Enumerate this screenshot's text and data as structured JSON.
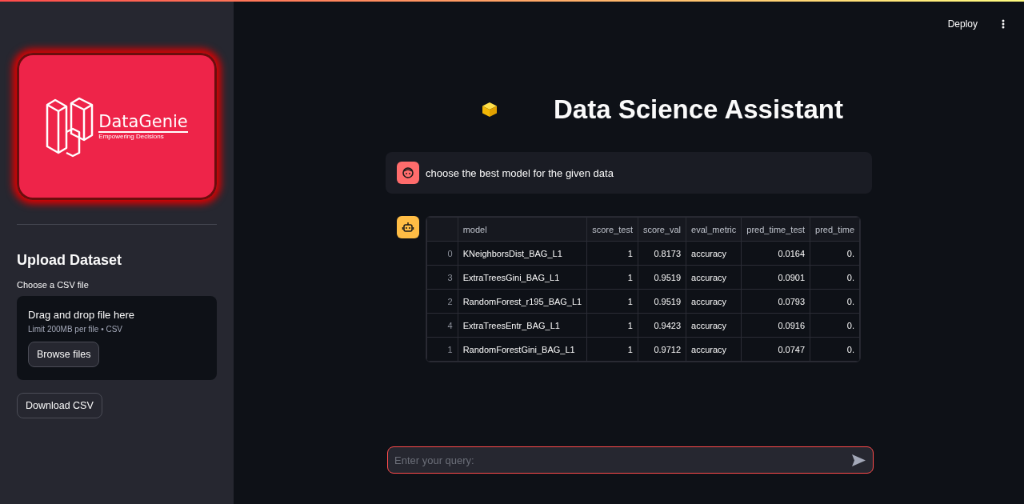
{
  "header": {
    "deploy": "Deploy"
  },
  "sidebar": {
    "logo": {
      "name": "DataGenie",
      "tagline": "Empowering Decisions"
    },
    "upload": {
      "title": "Upload Dataset",
      "label": "Choose a CSV file",
      "drop_text": "Drag and drop file here",
      "limit": "Limit 200MB per file • CSV",
      "browse": "Browse files"
    },
    "download": "Download CSV"
  },
  "title": "Data Science Assistant",
  "messages": [
    {
      "kind": "user",
      "text": "choose the best model for the given data"
    },
    {
      "kind": "assistant",
      "table": {
        "columns": [
          "",
          "model",
          "score_test",
          "score_val",
          "eval_metric",
          "pred_time_test",
          "pred_time"
        ],
        "rows": [
          [
            "0",
            "KNeighborsDist_BAG_L1",
            "1",
            "0.8173",
            "accuracy",
            "0.0164",
            "0."
          ],
          [
            "3",
            "ExtraTreesGini_BAG_L1",
            "1",
            "0.9519",
            "accuracy",
            "0.0901",
            "0."
          ],
          [
            "2",
            "RandomForest_r195_BAG_L1",
            "1",
            "0.9519",
            "accuracy",
            "0.0793",
            "0."
          ],
          [
            "4",
            "ExtraTreesEntr_BAG_L1",
            "1",
            "0.9423",
            "accuracy",
            "0.0916",
            "0."
          ],
          [
            "1",
            "RandomForestGini_BAG_L1",
            "1",
            "0.9712",
            "accuracy",
            "0.0747",
            "0."
          ]
        ]
      }
    }
  ],
  "chat_input": {
    "placeholder": "Enter your query:"
  }
}
